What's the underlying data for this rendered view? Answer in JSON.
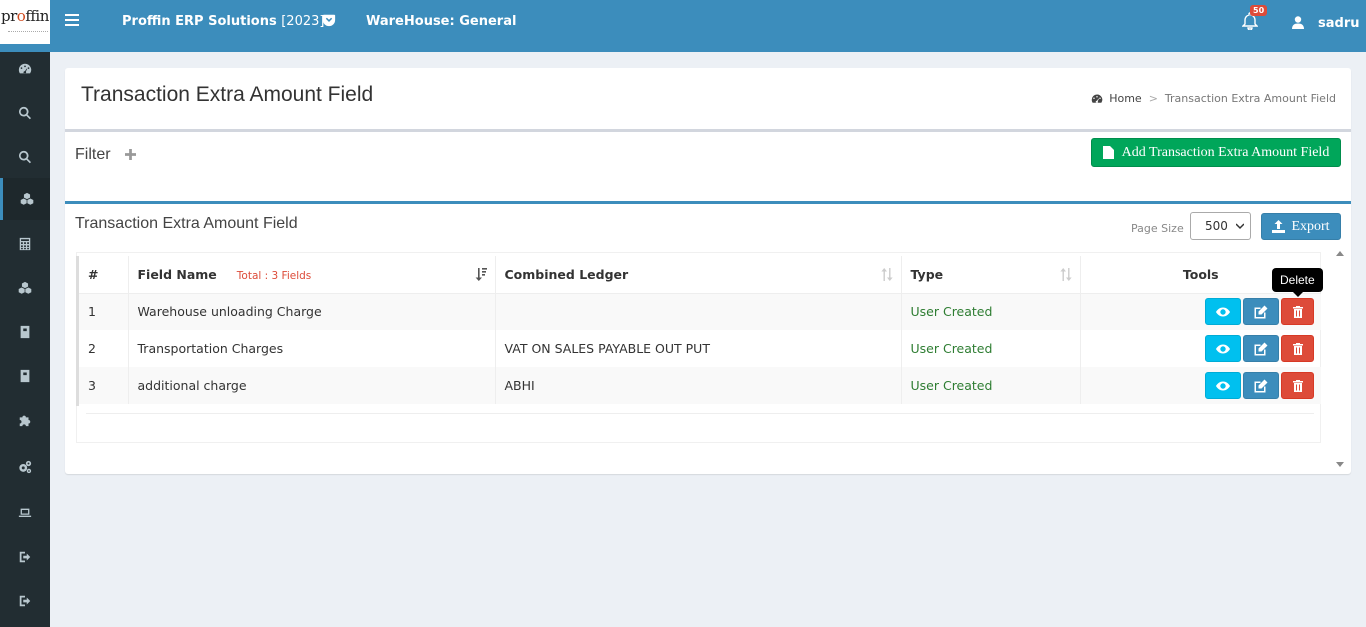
{
  "header": {
    "logo_text_a": "pr",
    "logo_text_b": "o",
    "logo_text_c": "ffin",
    "app_title": "Proffin ERP Solutions",
    "app_year": "[2023]",
    "warehouse": "WareHouse: General",
    "notification_count": "50",
    "user_name": "sadru",
    "bar_color": "#3c8dbc"
  },
  "sidebar": {
    "items": [
      {
        "icon": "dashboard-icon"
      },
      {
        "icon": "search-icon"
      },
      {
        "icon": "search-icon"
      },
      {
        "icon": "cubes-icon",
        "active": true
      },
      {
        "icon": "calculator-icon"
      },
      {
        "icon": "cubes-icon"
      },
      {
        "icon": "book-icon"
      },
      {
        "icon": "book-icon"
      },
      {
        "icon": "puzzle-icon"
      },
      {
        "icon": "cogs-icon"
      },
      {
        "icon": "laptop-icon"
      },
      {
        "icon": "sign-out-icon"
      },
      {
        "icon": "sign-out-icon"
      }
    ]
  },
  "page": {
    "title": "Transaction Extra Amount Field",
    "breadcrumb_home": "Home",
    "breadcrumb_sep": ">",
    "breadcrumb_current": "Transaction Extra Amount Field"
  },
  "filter": {
    "title": "Filter",
    "add_button_label": "Add Transaction Extra Amount Field"
  },
  "list": {
    "title": "Transaction Extra Amount Field",
    "page_size_label": "Page Size",
    "page_size_value": "500",
    "export_label": "Export",
    "columns": {
      "index": "#",
      "field_name": "Field Name",
      "total": "Total : 3 Fields",
      "combined_ledger": "Combined Ledger",
      "type": "Type",
      "tools": "Tools"
    },
    "rows": [
      {
        "index": "1",
        "field_name": "Warehouse unloading Charge",
        "combined_ledger": "",
        "type": "User Created"
      },
      {
        "index": "2",
        "field_name": "Transportation Charges",
        "combined_ledger": "VAT ON SALES PAYABLE OUT PUT",
        "type": "User Created"
      },
      {
        "index": "3",
        "field_name": "additional charge",
        "combined_ledger": "ABHI",
        "type": "User Created"
      }
    ],
    "tooltip": "Delete"
  }
}
